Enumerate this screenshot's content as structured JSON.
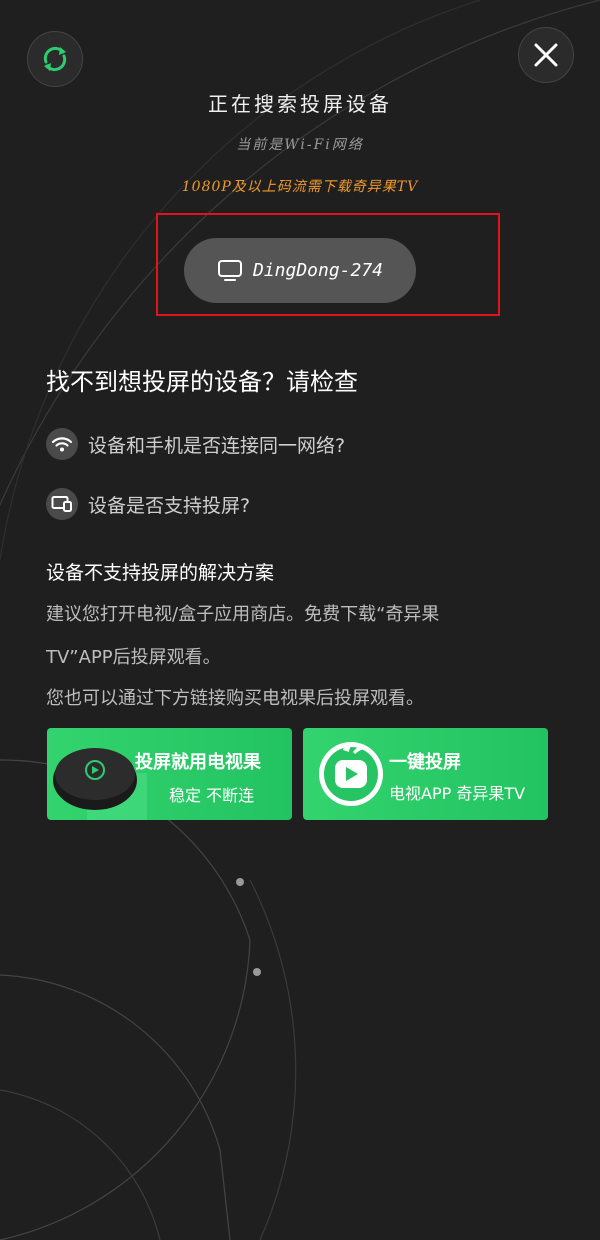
{
  "header": {
    "title": "正在搜索投屏设备",
    "wifi_status": "当前是Wi-Fi网络",
    "promo": "1080P及以上码流需下载奇异果TV"
  },
  "device": {
    "name": "DingDong-274"
  },
  "help": {
    "title": "找不到想投屏的设备？请检查",
    "checks": [
      {
        "icon": "wifi-icon",
        "text": "设备和手机是否连接同一网络?"
      },
      {
        "icon": "cast-device-icon",
        "text": "设备是否支持投屏?"
      }
    ]
  },
  "solution": {
    "title": "设备不支持投屏的解决方案",
    "lines": [
      "建议您打开电视/盒子应用商店。免费下载“奇异果",
      "TV”APP后投屏观看。",
      "您也可以通过下方链接购买电视果后投屏观看。"
    ]
  },
  "banners": [
    {
      "title": "投屏就用电视果",
      "subtitle": "稳定  不断连"
    },
    {
      "title": "一键投屏",
      "subtitle": "电视APP  奇异果TV"
    }
  ],
  "colors": {
    "background": "#1f1f1f",
    "accent_green": "#2ecc71",
    "promo_orange": "#f0992d",
    "highlight_red": "#e0141e"
  },
  "icons": {
    "refresh": "refresh-icon",
    "close": "close-icon",
    "device": "tv-icon"
  }
}
